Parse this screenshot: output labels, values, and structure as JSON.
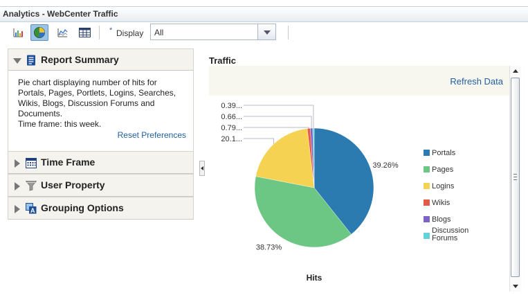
{
  "window": {
    "title": "Analytics - WebCenter Traffic"
  },
  "toolbar": {
    "buttons": [
      {
        "name": "bar-chart",
        "active": false
      },
      {
        "name": "pie-chart",
        "active": true
      },
      {
        "name": "line-chart",
        "active": false
      },
      {
        "name": "table",
        "active": false
      }
    ],
    "display_required_marker": "*",
    "display_label": "Display",
    "display_value": "All"
  },
  "left_panel": {
    "report_summary": {
      "title": "Report Summary",
      "description": "Pie chart displaying number of hits for Portals, Pages, Portlets, Logins, Searches, Wikis, Blogs, Discussion Forums and Documents.",
      "time_frame": "Time frame: this week.",
      "reset_link": "Reset Preferences"
    },
    "sections": [
      {
        "title": "Time Frame",
        "icon": "calendar-icon"
      },
      {
        "title": "User Property",
        "icon": "filter-icon"
      },
      {
        "title": "Grouping Options",
        "icon": "grouping-icon"
      }
    ]
  },
  "main": {
    "title": "Traffic",
    "refresh_link": "Refresh Data"
  },
  "chart_data": {
    "type": "pie",
    "xlabel": "Hits",
    "slices": [
      {
        "name": "Portals",
        "value": 39.26,
        "color": "#2b7bb0",
        "label": "39.26%"
      },
      {
        "name": "Pages",
        "value": 38.73,
        "color": "#6cc784",
        "label": "38.73%"
      },
      {
        "name": "Logins",
        "value": 20.1,
        "color": "#f6d252",
        "label": "20.1..."
      },
      {
        "name": "Wikis",
        "value": 0.79,
        "color": "#e45a47",
        "label": "0.79..."
      },
      {
        "name": "Blogs",
        "value": 0.66,
        "color": "#7f63c4",
        "label": "0.66..."
      },
      {
        "name": "Discussion Forums",
        "value": 0.39,
        "color": "#66d2d8",
        "label": "0.39..."
      }
    ],
    "legend": {
      "position": "right"
    }
  }
}
